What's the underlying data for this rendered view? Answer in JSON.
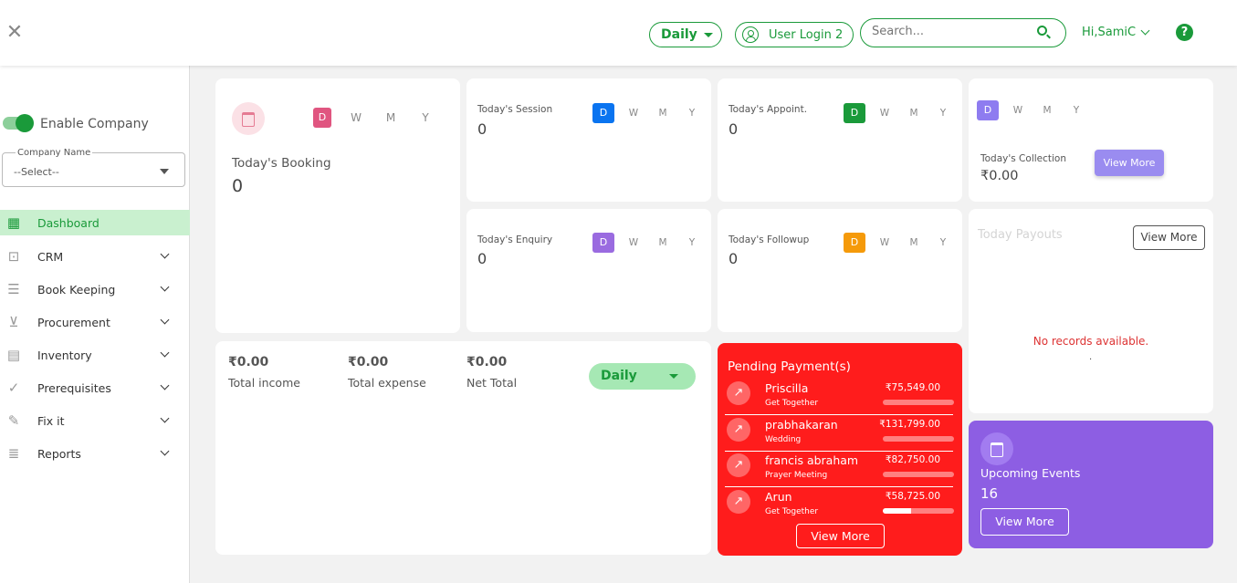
{
  "header": {
    "period_label": "Daily",
    "user_label": "User Login 2",
    "search_placeholder": "Search...",
    "greeting": "Hi,SamiC",
    "help_label": "?"
  },
  "sidebar": {
    "enable_company_label": "Enable Company",
    "company_field_label": "Company Name",
    "company_field_value": "--Select--",
    "items": [
      {
        "label": "Dashboard",
        "icon": "dashboard-icon"
      },
      {
        "label": "CRM",
        "icon": "briefcase-icon"
      },
      {
        "label": "Book Keeping",
        "icon": "clipboard-icon"
      },
      {
        "label": "Procurement",
        "icon": "cart-icon"
      },
      {
        "label": "Inventory",
        "icon": "archive-icon"
      },
      {
        "label": "Prerequisites",
        "icon": "check-circle-icon"
      },
      {
        "label": "Fix it",
        "icon": "wrench-icon"
      },
      {
        "label": "Reports",
        "icon": "list-icon"
      }
    ]
  },
  "period_letters": {
    "d": "D",
    "w": "W",
    "m": "M",
    "y": "Y"
  },
  "booking": {
    "label": "Today's Booking",
    "value": "0",
    "accent": "#e05580"
  },
  "session": {
    "label": "Today's Session",
    "value": "0",
    "accent": "#0a74f0"
  },
  "appointment": {
    "label": "Today's Appoint.",
    "value": "0",
    "accent": "#1a9a3a"
  },
  "collection": {
    "label": "Today's Collection",
    "value": "₹0.00",
    "button": "View More",
    "accent": "#8e7cf0"
  },
  "enquiry": {
    "label": "Today's Enquiry",
    "value": "0",
    "accent": "#9a6be0"
  },
  "followup": {
    "label": "Today's Followup",
    "value": "0",
    "accent": "#f59a0a"
  },
  "payouts": {
    "title": "Today Payouts",
    "button": "View More",
    "empty": "No records available.",
    "dot": "."
  },
  "totals": {
    "income_value": "₹0.00",
    "income_label": "Total income",
    "expense_value": "₹0.00",
    "expense_label": "Total expense",
    "net_value": "₹0.00",
    "net_label": "Net Total",
    "period": "Daily"
  },
  "pending": {
    "title": "Pending Payment(s)",
    "rows": [
      {
        "name": "Priscilla",
        "event": "Get Together",
        "amount": "₹75,549.00",
        "progress": 0
      },
      {
        "name": "prabhakaran",
        "event": "Wedding",
        "amount": "₹131,799.00",
        "progress": 0
      },
      {
        "name": "francis abraham",
        "event": "Prayer Meeting",
        "amount": "₹82,750.00",
        "progress": 0
      },
      {
        "name": "Arun",
        "event": "Get Together",
        "amount": "₹58,725.00",
        "progress": 0.4
      }
    ],
    "button": "View More"
  },
  "events": {
    "label": "Upcoming Events",
    "count": "16",
    "button": "View More"
  }
}
